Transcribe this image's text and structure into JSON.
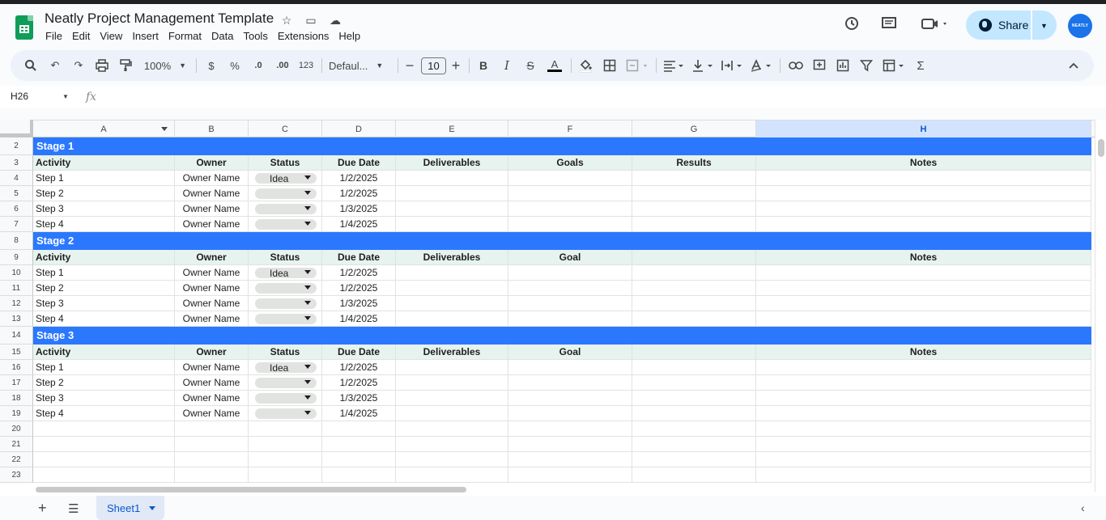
{
  "doc": {
    "title": "Neatly Project Management Template",
    "avatar_text": "NEATLY"
  },
  "menu": [
    "File",
    "Edit",
    "View",
    "Insert",
    "Format",
    "Data",
    "Tools",
    "Extensions",
    "Help"
  ],
  "share": {
    "label": "Share"
  },
  "toolbar": {
    "zoom": "100%",
    "currency": "$",
    "percent": "%",
    "dec_decrease": ".0",
    "dec_increase": ".00",
    "number_format": "123",
    "font": "Defaul...",
    "font_size": "10"
  },
  "formula_bar": {
    "cell_ref": "H26",
    "fx": "fx"
  },
  "columns": [
    "A",
    "B",
    "C",
    "D",
    "E",
    "F",
    "G",
    "H"
  ],
  "selected_column": "H",
  "rows": [
    {
      "num": "2",
      "type": "stage",
      "label": "Stage 1"
    },
    {
      "num": "3",
      "type": "header",
      "cells": [
        "Activity",
        "Owner",
        "Status",
        "Due Date",
        "Deliverables",
        "Goals",
        "Results",
        "Notes"
      ]
    },
    {
      "num": "4",
      "type": "data",
      "cells": [
        "Step 1",
        "Owner Name",
        "Idea",
        "1/2/2025",
        "",
        "",
        "",
        ""
      ]
    },
    {
      "num": "5",
      "type": "data",
      "cells": [
        "Step 2",
        "Owner Name",
        "",
        "1/2/2025",
        "",
        "",
        "",
        ""
      ]
    },
    {
      "num": "6",
      "type": "data",
      "cells": [
        "Step 3",
        "Owner Name",
        "",
        "1/3/2025",
        "",
        "",
        "",
        ""
      ]
    },
    {
      "num": "7",
      "type": "data",
      "cells": [
        "Step 4",
        "Owner Name",
        "",
        "1/4/2025",
        "",
        "",
        "",
        ""
      ]
    },
    {
      "num": "8",
      "type": "stage",
      "label": "Stage 2"
    },
    {
      "num": "9",
      "type": "header",
      "cells": [
        "Activity",
        "Owner",
        "Status",
        "Due Date",
        "Deliverables",
        "Goal",
        "",
        "Notes"
      ]
    },
    {
      "num": "10",
      "type": "data",
      "cells": [
        "Step 1",
        "Owner Name",
        "Idea",
        "1/2/2025",
        "",
        "",
        "",
        ""
      ]
    },
    {
      "num": "11",
      "type": "data",
      "cells": [
        "Step 2",
        "Owner Name",
        "",
        "1/2/2025",
        "",
        "",
        "",
        ""
      ]
    },
    {
      "num": "12",
      "type": "data",
      "cells": [
        "Step 3",
        "Owner Name",
        "",
        "1/3/2025",
        "",
        "",
        "",
        ""
      ]
    },
    {
      "num": "13",
      "type": "data",
      "cells": [
        "Step 4",
        "Owner Name",
        "",
        "1/4/2025",
        "",
        "",
        "",
        ""
      ]
    },
    {
      "num": "14",
      "type": "stage",
      "label": "Stage 3"
    },
    {
      "num": "15",
      "type": "header",
      "cells": [
        "Activity",
        "Owner",
        "Status",
        "Due Date",
        "Deliverables",
        "Goal",
        "",
        "Notes"
      ]
    },
    {
      "num": "16",
      "type": "data",
      "cells": [
        "Step 1",
        "Owner Name",
        "Idea",
        "1/2/2025",
        "",
        "",
        "",
        ""
      ]
    },
    {
      "num": "17",
      "type": "data",
      "cells": [
        "Step 2",
        "Owner Name",
        "",
        "1/2/2025",
        "",
        "",
        "",
        ""
      ]
    },
    {
      "num": "18",
      "type": "data",
      "cells": [
        "Step 3",
        "Owner Name",
        "",
        "1/3/2025",
        "",
        "",
        "",
        ""
      ]
    },
    {
      "num": "19",
      "type": "data",
      "cells": [
        "Step 4",
        "Owner Name",
        "",
        "1/4/2025",
        "",
        "",
        "",
        ""
      ]
    },
    {
      "num": "20",
      "type": "empty"
    },
    {
      "num": "21",
      "type": "empty"
    },
    {
      "num": "22",
      "type": "empty"
    },
    {
      "num": "23",
      "type": "empty"
    }
  ],
  "sheets": [
    {
      "name": "Sheet1",
      "active": true
    }
  ],
  "colors": {
    "stage_band": "#2b78ff",
    "header_band": "#e6f3ee",
    "share_button": "#c2e7ff",
    "selected_column": "#d3e3fd"
  }
}
